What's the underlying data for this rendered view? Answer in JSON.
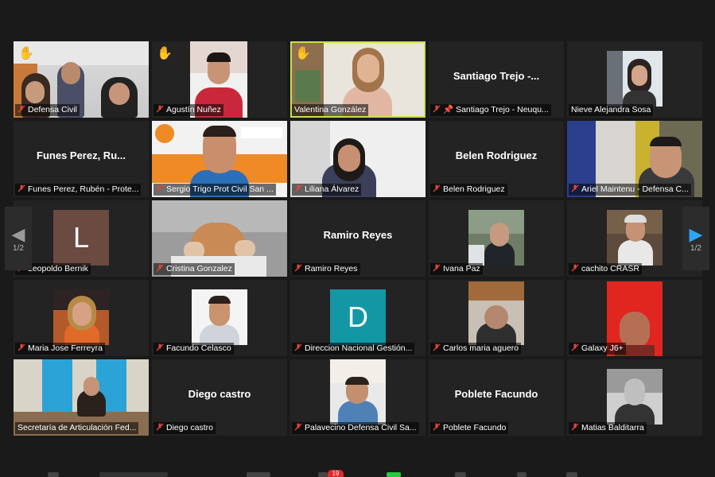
{
  "nav": {
    "prev_icon": "chevron-left-icon",
    "next_icon": "chevron-right-icon",
    "prev_page": "1/2",
    "next_page": "1/2"
  },
  "participants": [
    {
      "caption": "Defensa Civil",
      "display_name": "",
      "hand": true,
      "active": false,
      "avatar": ""
    },
    {
      "caption": "Agustín Nuñez",
      "display_name": "",
      "hand": true,
      "active": false,
      "avatar": ""
    },
    {
      "caption": "Valentina González",
      "display_name": "",
      "hand": true,
      "active": true,
      "avatar": ""
    },
    {
      "caption": "Santiago Trejo - Neuqu...",
      "display_name": "Santiago  Trejo  -...",
      "hand": false,
      "active": false,
      "avatar": ""
    },
    {
      "caption": "Nieve Alejandra Sosa",
      "display_name": "",
      "hand": false,
      "active": false,
      "avatar": ""
    },
    {
      "caption": "Funes Perez, Rubén - Prote...",
      "display_name": "Funes  Perez,  Ru...",
      "hand": false,
      "active": false,
      "avatar": ""
    },
    {
      "caption": "Sergio Trigo Prot Civil San ...",
      "display_name": "",
      "hand": false,
      "active": false,
      "avatar": ""
    },
    {
      "caption": "Liliana Álvarez",
      "display_name": "",
      "hand": false,
      "active": false,
      "avatar": ""
    },
    {
      "caption": "Belen Rodriguez",
      "display_name": "Belen Rodriguez",
      "hand": false,
      "active": false,
      "avatar": ""
    },
    {
      "caption": "Ariel Maintenu - Defensa C...",
      "display_name": "",
      "hand": false,
      "active": false,
      "avatar": ""
    },
    {
      "caption": "Leopoldo Bernik",
      "display_name": "",
      "hand": false,
      "active": false,
      "avatar": "L"
    },
    {
      "caption": "Cristina Gonzalez",
      "display_name": "",
      "hand": false,
      "active": false,
      "avatar": ""
    },
    {
      "caption": "Ramiro Reyes",
      "display_name": "Ramiro Reyes",
      "hand": false,
      "active": false,
      "avatar": ""
    },
    {
      "caption": "Ivana Paz",
      "display_name": "",
      "hand": false,
      "active": false,
      "avatar": ""
    },
    {
      "caption": "cachito CRASR",
      "display_name": "",
      "hand": false,
      "active": false,
      "avatar": ""
    },
    {
      "caption": "Maria Jose Ferreyra",
      "display_name": "",
      "hand": false,
      "active": false,
      "avatar": ""
    },
    {
      "caption": "Facundo Celasco",
      "display_name": "",
      "hand": false,
      "active": false,
      "avatar": ""
    },
    {
      "caption": "Direccion Nacional Gestión...",
      "display_name": "",
      "hand": false,
      "active": false,
      "avatar": "D"
    },
    {
      "caption": "Carlos maria aguero",
      "display_name": "",
      "hand": false,
      "active": false,
      "avatar": ""
    },
    {
      "caption": "Galaxy J6+",
      "display_name": "",
      "hand": false,
      "active": false,
      "avatar": ""
    },
    {
      "caption": "Secretaría de Articulación Fed...",
      "display_name": "",
      "hand": false,
      "active": false,
      "avatar": ""
    },
    {
      "caption": "Diego castro",
      "display_name": "Diego castro",
      "hand": false,
      "active": false,
      "avatar": ""
    },
    {
      "caption": "Palavecino Defensa Civil Sa...",
      "display_name": "",
      "hand": false,
      "active": false,
      "avatar": ""
    },
    {
      "caption": "Poblete Facundo",
      "display_name": "Poblete Facundo",
      "hand": false,
      "active": false,
      "avatar": ""
    },
    {
      "caption": "Matias Balditarra",
      "display_name": "",
      "hand": false,
      "active": false,
      "avatar": ""
    }
  ],
  "toolbar": {
    "chat_badge": "19"
  },
  "colors": {
    "active_border": "#c7e04a",
    "hand": "#f4c531",
    "muted_mic": "#e0453a",
    "next_arrow": "#2ea5f5",
    "badge": "#e02828"
  }
}
